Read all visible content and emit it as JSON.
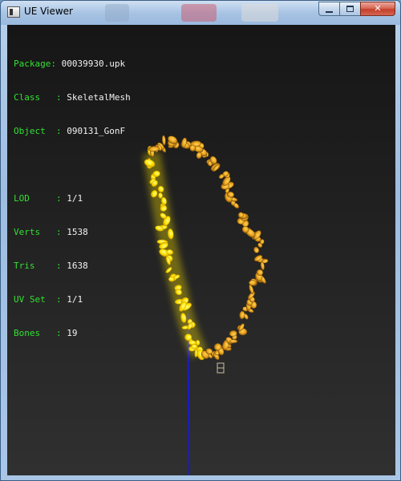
{
  "window": {
    "title": "UE Viewer"
  },
  "caption_buttons": {
    "close_glyph": "✕"
  },
  "info": {
    "package_label": "Package",
    "package_value": "00039930.upk",
    "class_label": "Class",
    "class_value": "SkeletalMesh",
    "object_label": "Object",
    "object_value": "090131_GonF",
    "lod_label": "LOD",
    "lod_value": "1/1",
    "verts_label": "Verts",
    "verts_value": "1538",
    "tris_label": "Tris",
    "tris_value": "1638",
    "uvset_label": "UV Set",
    "uvset_value": "1/1",
    "bones_label": "Bones",
    "bones_value": "19"
  },
  "colors": {
    "label_green": "#33e033",
    "value_white": "#f2f2f2",
    "mesh_bright": "#ffe600",
    "mesh_orange": "#e8a21a",
    "mesh_brown": "#8a5a12",
    "axis_blue": "#1a1ad0"
  },
  "icons": {
    "app": "ue-viewer-app-icon",
    "minimize": "minimize-icon",
    "maximize": "maximize-icon",
    "close": "close-icon"
  }
}
